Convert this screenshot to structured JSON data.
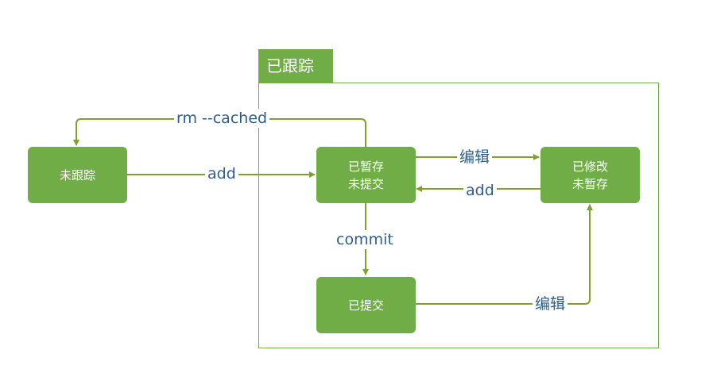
{
  "group": {
    "label": "已跟踪"
  },
  "nodes": {
    "untracked": [
      "未跟踪"
    ],
    "staged": [
      "已暂存",
      "未提交"
    ],
    "modified": [
      "已修改",
      "未暂存"
    ],
    "committed": [
      "已提交"
    ]
  },
  "edges": {
    "rm_cached": "rm --cached",
    "add_untracked": "add",
    "edit_staged": "编辑",
    "add_modified": "add",
    "commit": "commit",
    "edit_committed": "编辑"
  },
  "colors": {
    "node_fill": "#70ad47",
    "arrow": "#7ea22b",
    "label_text": "#2e5f8a"
  }
}
